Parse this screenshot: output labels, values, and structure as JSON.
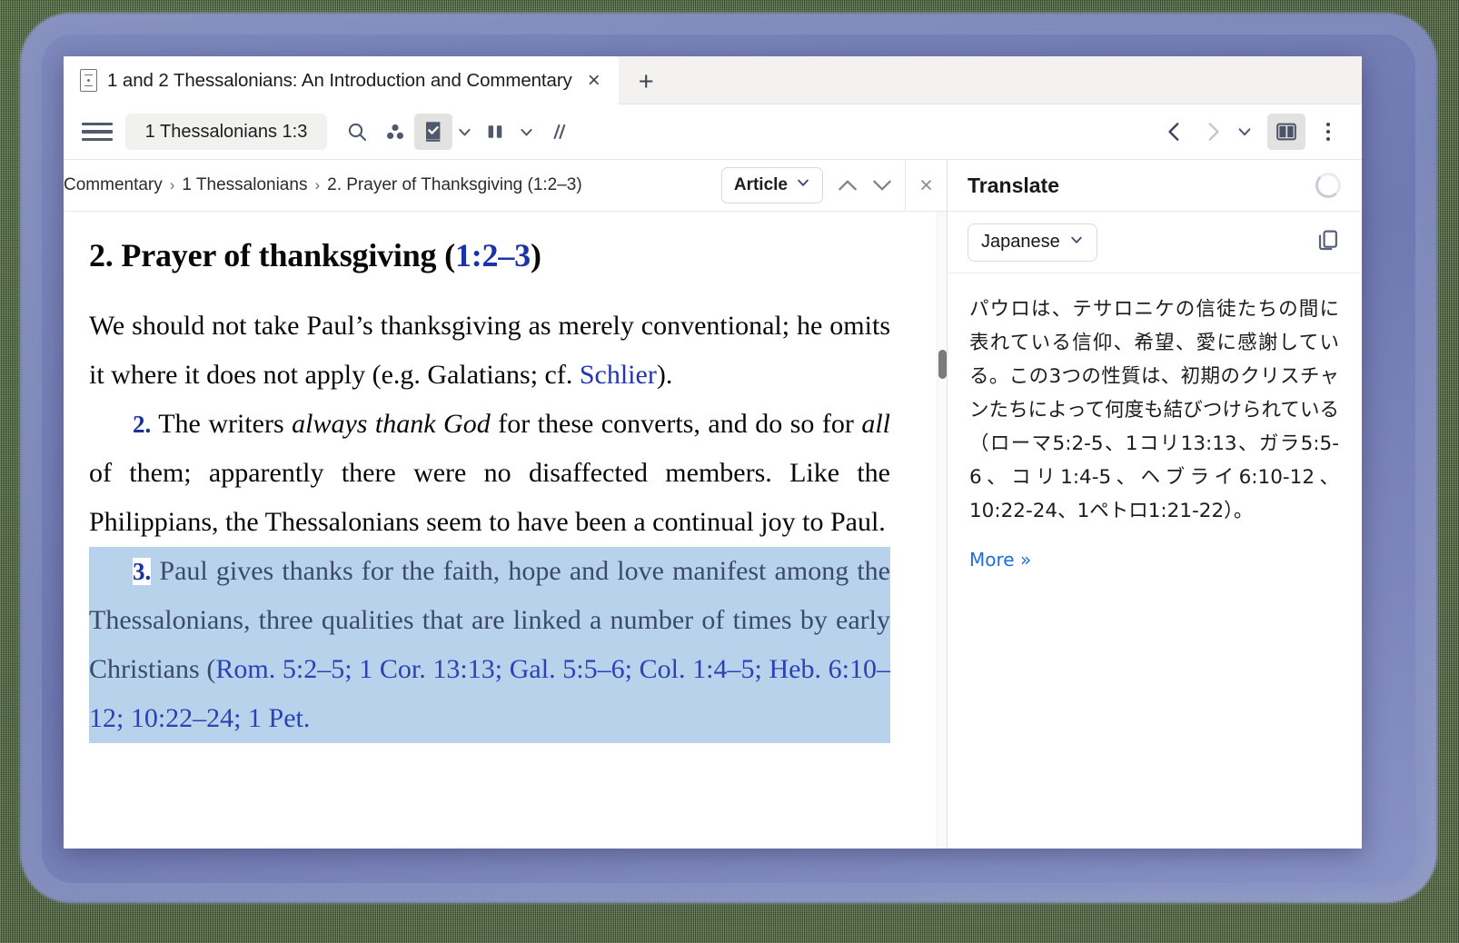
{
  "tab": {
    "title": "1 and 2 Thessalonians: An Introduction and Commentary",
    "close_label": "×",
    "new_tab_label": "+",
    "favicon": "book-favicon-icon"
  },
  "toolbar": {
    "menu_icon": "hamburger-menu-icon",
    "reference": "1 Thessalonians 1:3",
    "search_icon": "search-icon",
    "cluster_icon": "three-dot-cluster-icon",
    "book_check_icon": "book-check-icon",
    "book_check_chevron": "chevron-down-icon",
    "columns_icon": "two-column-icon",
    "columns_chevron": "chevron-down-icon",
    "slashes_icon": "double-slash-icon",
    "back_icon": "chevron-left-icon",
    "forward_icon": "chevron-right-icon",
    "history_chevron": "chevron-down-icon",
    "split_pane_icon": "split-pane-icon",
    "kebab_icon": "kebab-menu-icon"
  },
  "breadcrumb": {
    "items": [
      "Commentary",
      "1 Thessalonians",
      "2. Prayer of Thanksgiving (1:2–3)"
    ],
    "separator": "›",
    "article_select_label": "Article",
    "article_select_chevron": "chevron-down-icon",
    "prev_icon": "chevron-up-icon",
    "next_icon": "chevron-down-icon",
    "close_label": "×"
  },
  "article": {
    "heading_prefix": "2. Prayer of thanksgiving (",
    "heading_ref": "1:2–3",
    "heading_suffix": ")",
    "p1_a": "We should not take Paul’s thanksgiving as merely conventional; he omits it where it does not apply (e.g. Galatians; cf. ",
    "p1_link": "Schlier",
    "p1_b": ").",
    "p2_num": "2.",
    "p2_a": " The writers ",
    "p2_i1": "always thank God",
    "p2_b": " for these converts, and do so for ",
    "p2_i2": "all",
    "p2_c": " of them; apparently there were no disaffected members. Like the Philippians, the Thessalonians seem to have been a continual joy to Paul.",
    "p3_num": "3.",
    "p3_a": " Paul gives thanks for the faith, hope and love manifest among the Thessalonians, three qualities that are linked a number of times by early Christians (",
    "p3_refs": "Rom. 5:2–5; 1 Cor. 13:13; Gal. 5:5–6; Col. 1:4–5; Heb. 6:10–12; 10:22–24; 1 Pet."
  },
  "translate": {
    "title": "Translate",
    "spinner_icon": "loading-spinner-icon",
    "language": "Japanese",
    "language_chevron": "chevron-down-icon",
    "copy_icon": "copy-icon",
    "text": "パウロは、テサロニケの信徒たちの間に表れている信仰、希望、愛に感謝している。この3つの性質は、初期のクリスチャンたちによって何度も結びつけられている（ローマ5:2-5、1コリ13:13、ガラ5:5-6、コリ1:4-5、ヘブライ6:10-12、10:22-24、1ペトロ1:21-22）。",
    "more_label": "More »"
  },
  "colors": {
    "accent_link": "#2236ae",
    "selection_highlight": "#b7d2ea",
    "verse_number": "#19309f",
    "more_link": "#1a6fe0",
    "toolbar_icon": "#4f586d"
  }
}
